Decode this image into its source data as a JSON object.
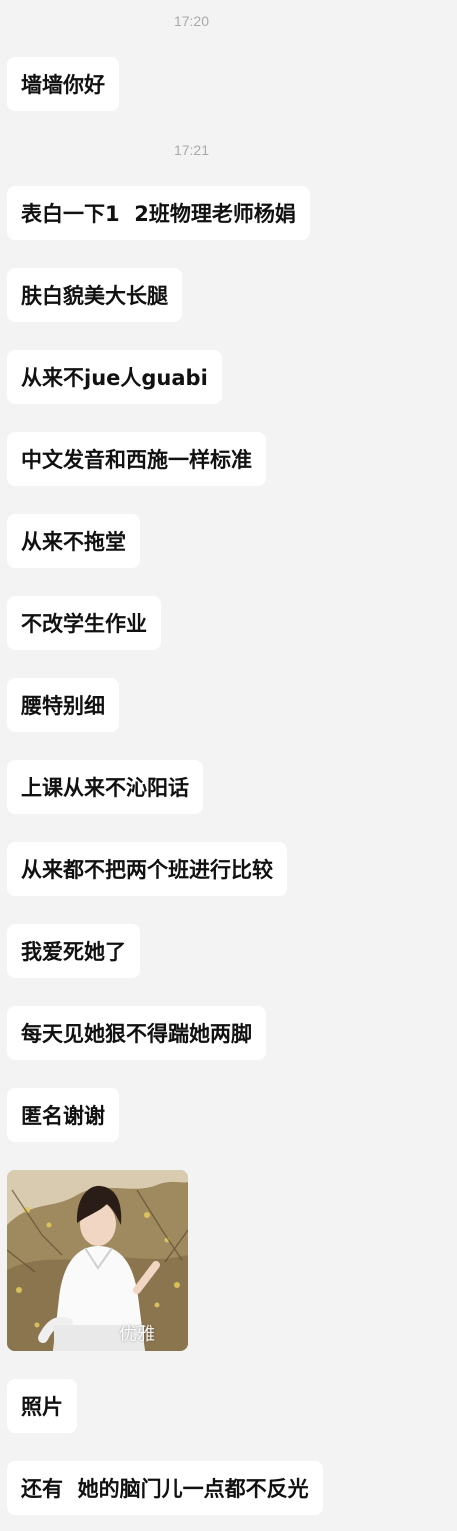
{
  "timestamps": [
    "17:20",
    "17:21"
  ],
  "messages": [
    "墙墙你好",
    "表白一下1  2班物理老师杨娟",
    "肤白貌美大长腿",
    "从来不jue人guabi",
    "中文发音和西施一样标准",
    "从来不拖堂",
    "不改学生作业",
    "腰特别细",
    "上课从来不沁阳话",
    "从来都不把两个班进行比较",
    "我爱死她了",
    "每天见她狠不得踹她两脚",
    "匿名谢谢",
    "照片",
    "还有  她的脑门儿一点都不反光"
  ],
  "photo": {
    "watermark": "优雅"
  }
}
